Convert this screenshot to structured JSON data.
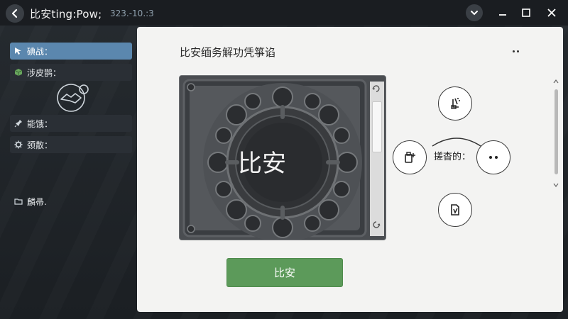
{
  "window": {
    "title": "比安ting:Pow;",
    "version": "323.-10.:3"
  },
  "sidebar": {
    "items": [
      {
        "label": "碘战：",
        "icon": "cursor-arrow-icon",
        "active": true
      },
      {
        "label": "涉皮鹊：",
        "icon": "cube-icon",
        "active": false
      },
      {
        "label": "能饿：",
        "icon": "pin-icon",
        "active": false
      },
      {
        "label": "颈散：",
        "icon": "gear-icon",
        "active": false
      },
      {
        "label": "麟帚.",
        "icon": "folder-icon",
        "active": false
      }
    ]
  },
  "panel": {
    "title": "比安缅务解功凭箏谄",
    "preview_label": "比安",
    "primary_button": "比安",
    "cluster_label": "搓杳的："
  },
  "colors": {
    "accent": "#5b87ae",
    "primary": "#5c9a5a",
    "panel_bg": "#f3f3f2",
    "app_bg": "#1e2226"
  }
}
